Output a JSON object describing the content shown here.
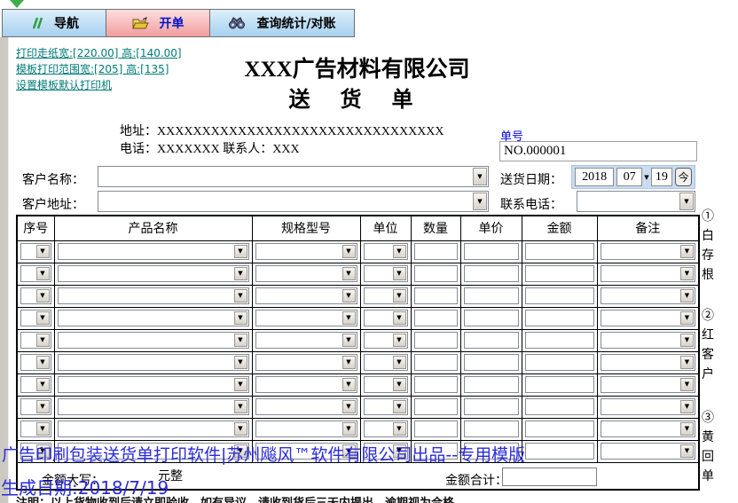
{
  "tabbar": {
    "tabs": [
      {
        "label": "导航"
      },
      {
        "label": "开单"
      },
      {
        "label": "查询统计/对账"
      }
    ]
  },
  "links": [
    "打印走纸宽:[220.00] 高:[140.00]",
    "模板打印范围宽:[205] 高:[135]",
    "设置模板默认打印机"
  ],
  "document": {
    "company": "XXX广告材料有限公司",
    "title": "送 货 单",
    "address_line": "地址：XXXXXXXXXXXXXXXXXXXXXXXXXXXXXXXX",
    "phone_line": "电话：XXXXXXX 联系人：XXX"
  },
  "order": {
    "no_label": "单号",
    "no_value": "NO.000001",
    "customer_name_label": "客户名称：",
    "customer_addr_label": "客户地址：",
    "date_label": "送货日期：",
    "date_year": "2018",
    "date_month": "07",
    "date_day": "19",
    "today_button": "今",
    "phone_label": "联系电话："
  },
  "table": {
    "headers": [
      "序号",
      "产品名称",
      "规格型号",
      "单位",
      "数量",
      "单价",
      "金额",
      "备注"
    ],
    "row_count": 10,
    "amount_words_label": "金额大写：",
    "amount_words_value": "元整",
    "total_label": "金额合计："
  },
  "copies": [
    "①白存根",
    "②红客户",
    "③黄回单"
  ],
  "watermark": {
    "line1": "广告印刷包装送货单打印软件|苏州飚风™软件有限公司出品--专用模版",
    "line2": "生成日期:2018/7/19"
  },
  "footnote": "注明：以上货物收到后请立即验收，如有异议，请收到货后三天内提出，逾期视为合格。",
  "colors": {
    "active_tab_pink": "#f19d9d",
    "inactive_tab_blue": "#a6d1ef",
    "link_teal": "#007a78",
    "label_blue": "#0000ee",
    "watermark_blue": "#2a2ada",
    "tab_active_text": "#0013cc",
    "icon_green": "#3fae49"
  }
}
